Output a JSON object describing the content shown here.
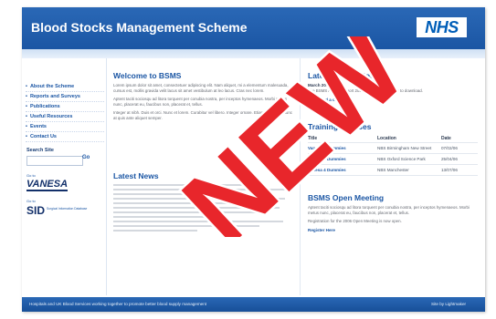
{
  "header": {
    "title": "Blood Stocks Management Scheme",
    "logo": "NHS"
  },
  "sidebar": {
    "items": [
      {
        "label": "About the Scheme"
      },
      {
        "label": "Reports and Surveys"
      },
      {
        "label": "Publications"
      },
      {
        "label": "Useful Resources"
      },
      {
        "label": "Events"
      },
      {
        "label": "Contact Us"
      }
    ],
    "search_title": "Search Site",
    "go_label": "Go",
    "goto_label_1": "Go to",
    "vanesa_logo": "VANESA",
    "goto_label_2": "Go to",
    "sid_logo": "SID",
    "sid_subtitle": "Surgical Information Database"
  },
  "main": {
    "welcome_title": "Welcome to BSMS",
    "welcome_paragraphs": [
      "Lorem ipsum dolor sit amet, consectetuer adipiscing elit. Nam aliquet, mi a elementum malesuada, cursus est, mollis gravida velit lacus sit amet vestibulum at leo lacus. Cras nec lorem.",
      "Aptent taciti sociosqu ad litora torquent per conubia nostra, per inceptos hymenaeos. Morbi metus nunc, placerat eu, faucibus non, placerat et, tellus.",
      "Integer at nibh. Duis et orci. Nunc et lorem. Curabitur vel libero. Integer ornare. Etiam venenatis nunc at quis ante aliquet semper."
    ],
    "news_title": "Latest News"
  },
  "right": {
    "publication_title": "Latest Publication",
    "publication_date": "March 2006",
    "publication_text": "The BSMS Annual Report 2004-05 is now available to download.",
    "publication_link": "Download a copy now",
    "courses_title": "Training Courses",
    "courses_headers": [
      "Title",
      "Location",
      "Date"
    ],
    "courses": [
      {
        "title": "Vanesa 4 Dummies",
        "location": "NBS Birmingham New Street",
        "date": "07/02/06"
      },
      {
        "title": "Vanesa 4 Dummies",
        "location": "NBS Oxford Science Park",
        "date": "25/04/06"
      },
      {
        "title": "Vanesa 4 Dummies",
        "location": "NBS Manchester",
        "date": "13/07/06"
      }
    ],
    "meeting_title": "BSMS Open Meeting",
    "meeting_text": "Aptent taciti sociosqu ad litora torquent per conubia nostra, per inceptos hymenaeos. Morbi metus nunc, placerat eu, faucibus non, placerat et, tellus.",
    "meeting_text2": "Registration for the 2006 Open Meeting is now open.",
    "meeting_link": "Register Here"
  },
  "footer": {
    "left": "Hospitals and UK Blood Services working together to promote better blood supply management",
    "right": "Site by Lightmaker"
  },
  "overlay": {
    "stamp_text": "NEW",
    "stamp_color": "#e8262b"
  },
  "colors": {
    "brand": "#1b56a4",
    "banner": "#2a68b6",
    "nhs_blue": "#005eb8"
  }
}
